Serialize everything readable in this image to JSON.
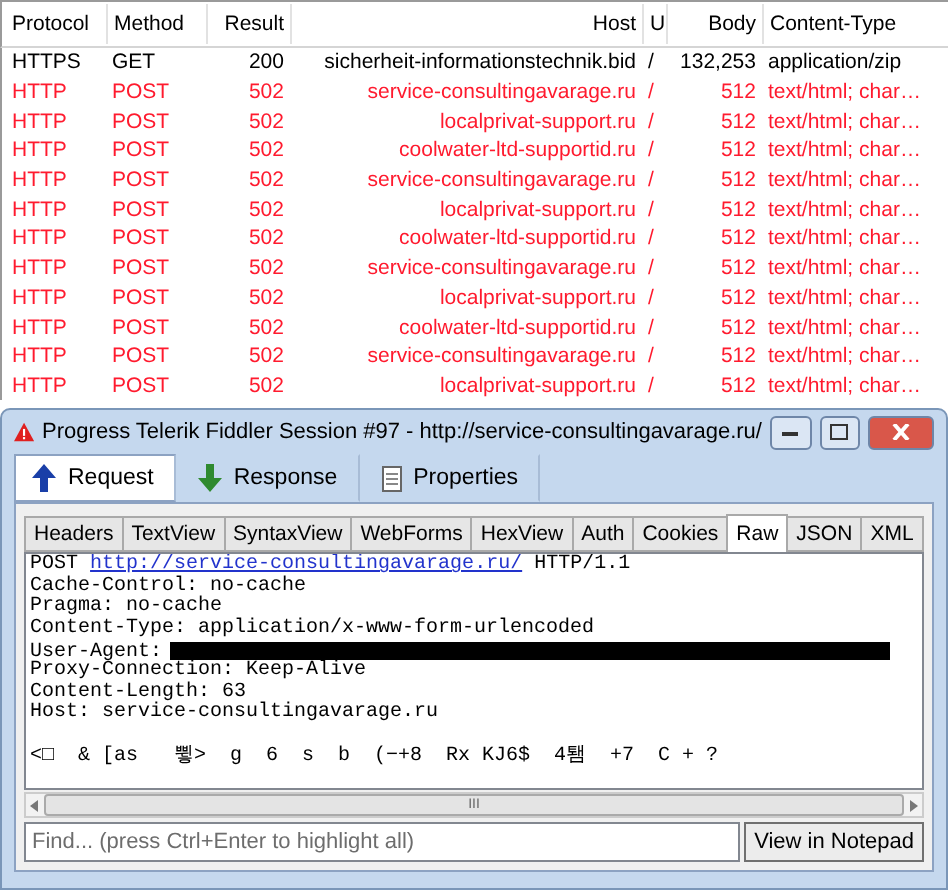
{
  "table": {
    "columns": [
      "Protocol",
      "Method",
      "Result",
      "Host",
      "U",
      "Body",
      "Content-Type"
    ],
    "rows": [
      {
        "cells": [
          "HTTPS",
          "GET",
          "200",
          "sicherheit-informationstechnik.bid",
          "/",
          "132,253",
          "application/zip"
        ],
        "color": "#000000"
      },
      {
        "cells": [
          "HTTP",
          "POST",
          "502",
          "service-consultingavarage.ru",
          "/",
          "512",
          "text/html; char…"
        ],
        "color": "#ff1a2e"
      },
      {
        "cells": [
          "HTTP",
          "POST",
          "502",
          "localprivat-support.ru",
          "/",
          "512",
          "text/html; char…"
        ],
        "color": "#ff1a2e"
      },
      {
        "cells": [
          "HTTP",
          "POST",
          "502",
          "coolwater-ltd-supportid.ru",
          "/",
          "512",
          "text/html; char…"
        ],
        "color": "#ff1a2e"
      },
      {
        "cells": [
          "HTTP",
          "POST",
          "502",
          "service-consultingavarage.ru",
          "/",
          "512",
          "text/html; char…"
        ],
        "color": "#ff1a2e"
      },
      {
        "cells": [
          "HTTP",
          "POST",
          "502",
          "localprivat-support.ru",
          "/",
          "512",
          "text/html; char…"
        ],
        "color": "#ff1a2e"
      },
      {
        "cells": [
          "HTTP",
          "POST",
          "502",
          "coolwater-ltd-supportid.ru",
          "/",
          "512",
          "text/html; char…"
        ],
        "color": "#ff1a2e"
      },
      {
        "cells": [
          "HTTP",
          "POST",
          "502",
          "service-consultingavarage.ru",
          "/",
          "512",
          "text/html; char…"
        ],
        "color": "#ff1a2e"
      },
      {
        "cells": [
          "HTTP",
          "POST",
          "502",
          "localprivat-support.ru",
          "/",
          "512",
          "text/html; char…"
        ],
        "color": "#ff1a2e"
      },
      {
        "cells": [
          "HTTP",
          "POST",
          "502",
          "coolwater-ltd-supportid.ru",
          "/",
          "512",
          "text/html; char…"
        ],
        "color": "#ff1a2e"
      },
      {
        "cells": [
          "HTTP",
          "POST",
          "502",
          "service-consultingavarage.ru",
          "/",
          "512",
          "text/html; char…"
        ],
        "color": "#ff1a2e"
      },
      {
        "cells": [
          "HTTP",
          "POST",
          "502",
          "localprivat-support.ru",
          "/",
          "512",
          "text/html; char…"
        ],
        "color": "#ff1a2e"
      }
    ]
  },
  "window": {
    "title": "Progress Telerik Fiddler Session #97 - http://service-consultingavarage.ru/",
    "tabs": [
      {
        "label": "Request",
        "kind": "up",
        "selected": true
      },
      {
        "label": "Response",
        "kind": "down",
        "selected": false
      },
      {
        "label": "Properties",
        "kind": "doc",
        "selected": false
      }
    ],
    "subtabs": [
      {
        "label": "Headers",
        "selected": false
      },
      {
        "label": "TextView",
        "selected": false
      },
      {
        "label": "SyntaxView",
        "selected": false
      },
      {
        "label": "WebForms",
        "selected": false
      },
      {
        "label": "HexView",
        "selected": false
      },
      {
        "label": "Auth",
        "selected": false
      },
      {
        "label": "Cookies",
        "selected": false
      },
      {
        "label": "Raw",
        "selected": true
      },
      {
        "label": "JSON",
        "selected": false
      },
      {
        "label": "XML",
        "selected": false
      }
    ],
    "raw": {
      "method": "POST",
      "url": "http://service-consultingavarage.ru/",
      "version": "HTTP/1.1",
      "lines": [
        {
          "kind": "text",
          "text": "Cache-Control: no-cache"
        },
        {
          "kind": "text",
          "text": "Pragma: no-cache"
        },
        {
          "kind": "text",
          "text": "Content-Type: application/x-www-form-urlencoded"
        },
        {
          "kind": "redacted",
          "text": "User-Agent:"
        },
        {
          "kind": "text",
          "text": "Proxy-Connection: Keep-Alive"
        },
        {
          "kind": "text",
          "text": "Content-Length: 63"
        },
        {
          "kind": "text",
          "text": "Host: service-consultingavarage.ru"
        },
        {
          "kind": "blank"
        },
        {
          "kind": "text",
          "text": "<□  & [as   쀻>  g  6  s  b  (−+8  Rx KJ6$  4퇨  +7  C + ?"
        }
      ]
    },
    "scrollbar_grip": "III",
    "find": {
      "placeholder": "Find... (press Ctrl+Enter to highlight all)"
    },
    "notepad_button": "View in Notepad"
  }
}
